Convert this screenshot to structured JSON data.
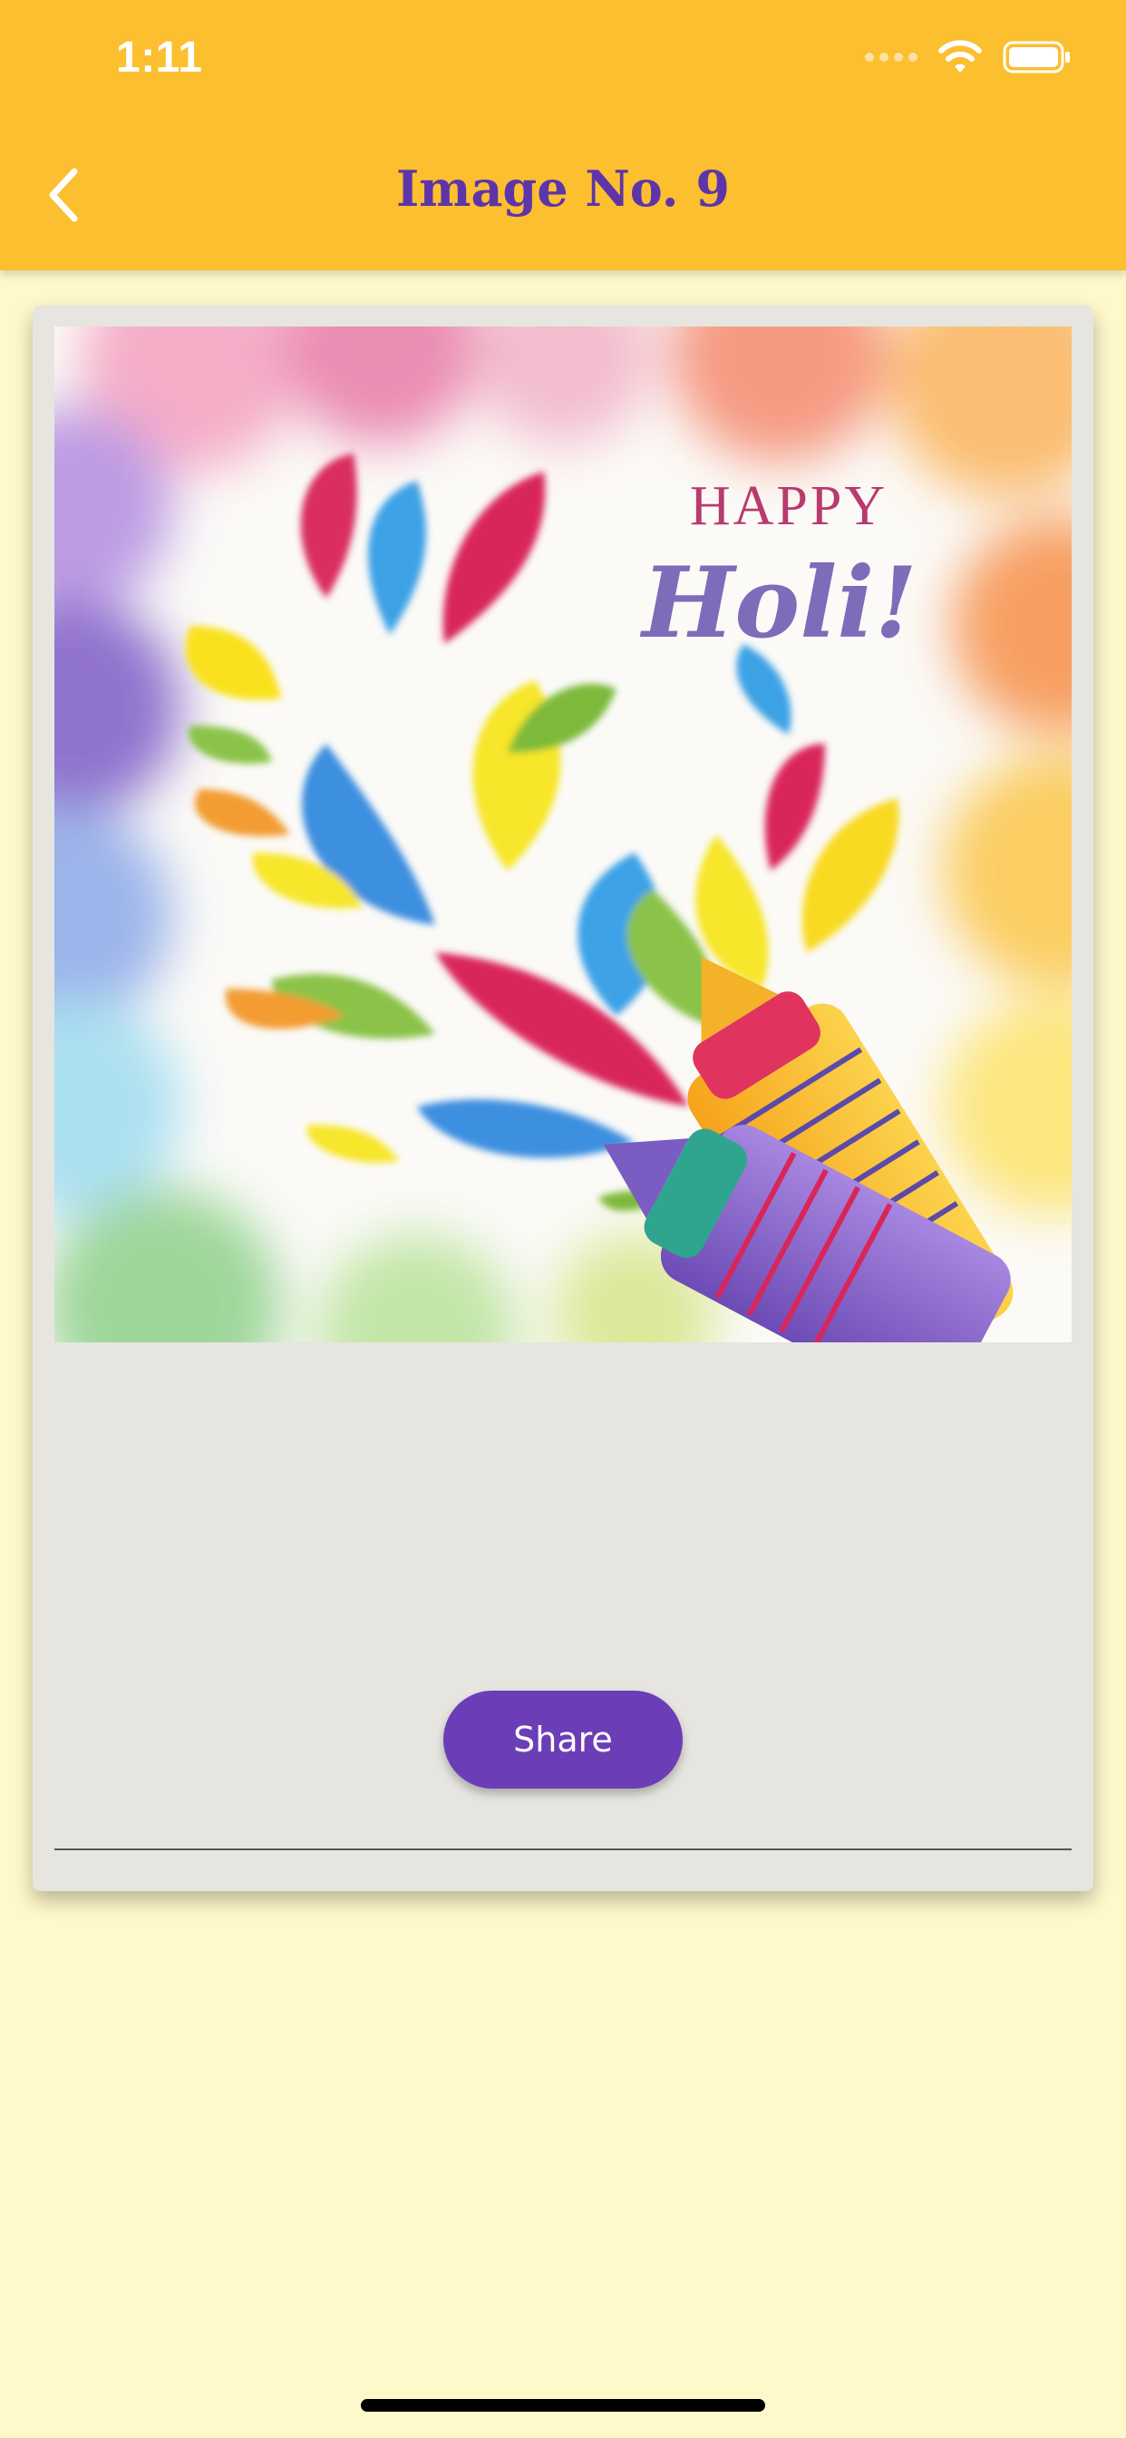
{
  "status_bar": {
    "time": "1:11"
  },
  "header": {
    "title": "Image No. 9",
    "back_icon": "chevron-left-icon"
  },
  "image": {
    "line1": "HAPPY",
    "line2": "Holi!"
  },
  "actions": {
    "share_label": "Share"
  },
  "colors": {
    "header_bg": "#FBBF2F",
    "page_bg": "#FFF8CB",
    "card_bg": "#E6E5E0",
    "accent": "#6B3DB6",
    "title_color": "#5E35A8"
  }
}
